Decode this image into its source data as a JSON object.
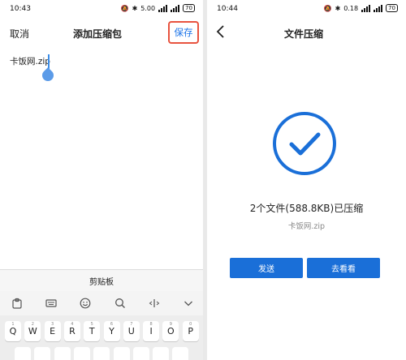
{
  "left": {
    "status": {
      "time": "10:43",
      "network": "5.00",
      "battery": "70"
    },
    "cancel_label": "取消",
    "title": "添加压缩包",
    "save_label": "保存",
    "filename_value": "卡饭网.zip",
    "keyboard": {
      "clipboard_label": "剪贴板",
      "toolbar_icons": [
        "clipboard-icon",
        "keyboard-icon",
        "emoji-icon",
        "search-icon",
        "cursor-move-icon",
        "collapse-icon"
      ],
      "row1": [
        "Q",
        "W",
        "E",
        "R",
        "T",
        "Y",
        "U",
        "I",
        "O",
        "P"
      ],
      "row1_numbers": [
        "1",
        "2",
        "3",
        "4",
        "5",
        "6",
        "7",
        "8",
        "9",
        "0"
      ]
    }
  },
  "right": {
    "status": {
      "time": "10:44",
      "network": "0.18",
      "battery": "70"
    },
    "title": "文件压缩",
    "result_text": "2个文件(588.8KB)已压缩",
    "result_filename": "卡饭网.zip",
    "send_label": "发送",
    "view_label": "去看看",
    "accent": "#1a6fd8"
  },
  "colors": {
    "highlight_border": "#e8533f",
    "link_blue": "#1a73e8"
  }
}
